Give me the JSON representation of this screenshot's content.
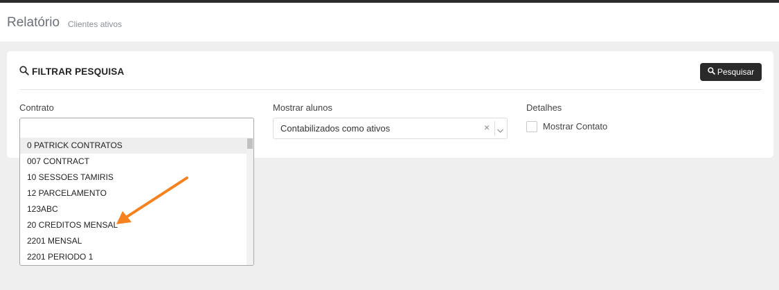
{
  "header": {
    "title": "Relatório",
    "subtitle": "Clientes ativos"
  },
  "filter": {
    "title": "FILTRAR PESQUISA",
    "search_button": "Pesquisar",
    "contract_label": "Contrato",
    "contract_options": [
      "0 PATRICK CONTRATOS",
      "007 CONTRACT",
      "10 SESSOES TAMIRIS",
      "12 PARCELAMENTO",
      "123ABC",
      "20 CREDITOS MENSAL",
      "2201 MENSAL",
      "2201 PERIODO 1"
    ],
    "show_students_label": "Mostrar alunos",
    "show_students_value": "Contabilizados como ativos",
    "details_label": "Detalhes",
    "show_contact_label": "Mostrar Contato"
  },
  "colors": {
    "accent_arrow": "#f5821f",
    "button_bg": "#2a2a2a"
  },
  "icons": [
    "search-icon",
    "clear-icon",
    "chevron-down-icon",
    "annotation-arrow"
  ]
}
